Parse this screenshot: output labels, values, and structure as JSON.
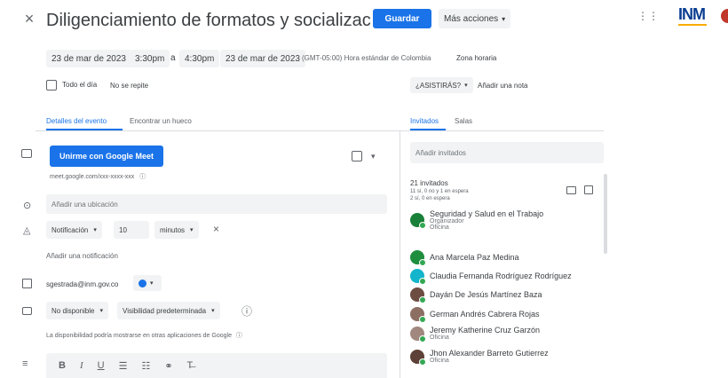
{
  "header": {
    "title": "Diligenciamiento de formatos y socializac",
    "save_label": "Guardar",
    "more_actions": "Más acciones",
    "brand": "INM"
  },
  "datetime": {
    "start_date": "23 de mar de 2023",
    "start_time": "3:30pm",
    "dash": "a",
    "end_time": "4:30pm",
    "end_date": "23 de mar de 2023",
    "timezone": "(GMT-05:00) Hora estándar de Colombia",
    "timezone_link": "Zona horaria",
    "allday": "Todo el día",
    "repeat": "No se repite",
    "required": "¿ASISTIRÁS?",
    "add_note": "Añadir una nota"
  },
  "tabs": {
    "details": "Detalles del evento",
    "find_time": "Encontrar un hueco",
    "guests": "Invitados",
    "rooms": "Salas"
  },
  "details": {
    "meet_button": "Unirme con Google Meet",
    "meet_sub": "meet.google.com/xxx-xxxx-xxx",
    "location_placeholder": "Añadir una ubicación",
    "notification_type": "Notificación",
    "notification_value": "10",
    "notification_unit": "minutos",
    "add_notification": "Añadir una notificación",
    "calendar_owner": "sgestrada@inm.gov.co",
    "availability": "No disponible",
    "visibility": "Visibilidad predeterminada",
    "availability_note": "La disponibilidad podría mostrarse en otras aplicaciones de Google"
  },
  "guests": {
    "add_placeholder": "Añadir invitados",
    "count": "21 invitados",
    "summary1": "11 sí, 0 no y 1 en espera",
    "summary2": "2 sí, 0 en espera",
    "list": [
      {
        "name": "Seguridad y Salud en el Trabajo",
        "sub1": "Organizador",
        "sub2": "Oficina",
        "color": "#188038"
      },
      {
        "name": "Ana Marcela Paz Medina",
        "sub1": "",
        "sub2": "",
        "color": "#1e8e3e"
      },
      {
        "name": "Claudia Fernanda Rodríguez Rodríguez",
        "sub1": "",
        "sub2": "",
        "color": "#12b5cb"
      },
      {
        "name": "Dayán De Jesús Martínez Baza",
        "sub1": "",
        "sub2": "",
        "color": "#6d4c41"
      },
      {
        "name": "German Andrés Cabrera Rojas",
        "sub1": "",
        "sub2": "",
        "color": "#8d6e63"
      },
      {
        "name": "Jeremy Katherine Cruz Garzón",
        "sub1": "Oficina",
        "sub2": "",
        "color": "#a1887f"
      },
      {
        "name": "Jhon Alexander Barreto Gutierrez",
        "sub1": "Oficina",
        "sub2": "",
        "color": "#5d4037"
      }
    ]
  },
  "toolbar": {
    "bold": "B",
    "italic": "I",
    "underline": "U",
    "ol": "☰",
    "ul": "☷",
    "link": "⚭",
    "clear": "T̶"
  },
  "colors": {
    "accent": "#1a73e8",
    "calendar_dot": "#1a73e8"
  }
}
